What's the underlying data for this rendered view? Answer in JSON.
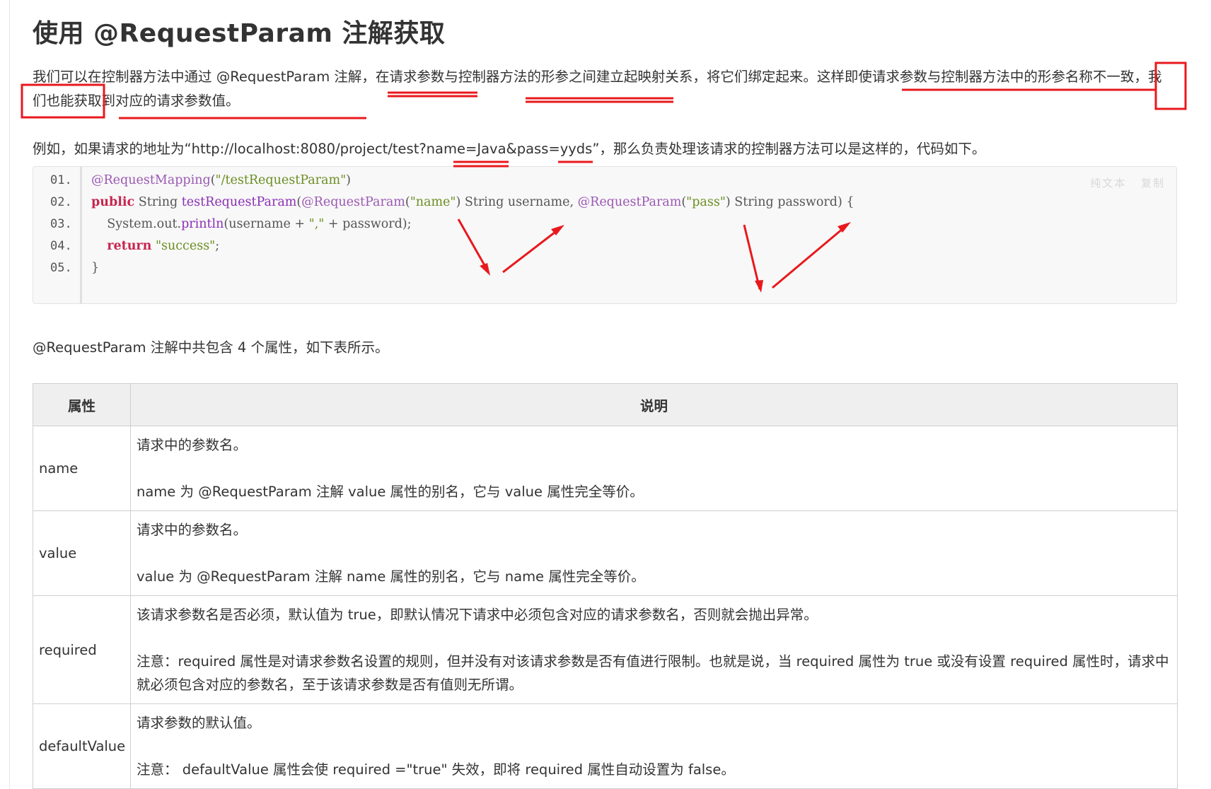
{
  "heading": "使用 @RequestParam 注解获取",
  "intro": {
    "text": "我们可以在控制器方法中通过 @RequestParam 注解，在请求参数与控制器方法的形参之间建立起映射关系，将它们绑定起来。这样即使请求参数与控制器方法中的形参名称不一致，我们也能获取到对应的请求参数值。"
  },
  "example": {
    "text": "例如，如果请求的地址为“http://localhost:8080/project/test?name=Java&pass=yyds”，那么负责处理该请求的控制器方法可以是这样的，代码如下。"
  },
  "code_block": {
    "toolbar": {
      "plain_text": "纯文本",
      "copy": "复制"
    },
    "line_numbers": [
      "01.",
      "02.",
      "03.",
      "04.",
      "05."
    ],
    "lines": [
      "@RequestMapping(\"/testRequestParam\")",
      "public String testRequestParam(@RequestParam(\"name\") String username, @RequestParam(\"pass\") String password) {",
      "    System.out.println(username + \",\" + password);",
      "    return \"success\";",
      "}"
    ]
  },
  "table_intro": "@RequestParam 注解中共包含 4 个属性，如下表所示。",
  "table": {
    "headers": [
      "属性",
      "说明"
    ],
    "rows": [
      {
        "attr": "name",
        "desc": [
          "请求中的参数名。",
          "name 为 @RequestParam 注解 value 属性的别名，它与 value 属性完全等价。"
        ]
      },
      {
        "attr": "value",
        "desc": [
          "请求中的参数名。",
          "value 为 @RequestParam 注解 name 属性的别名，它与 name 属性完全等价。"
        ]
      },
      {
        "attr": "required",
        "desc": [
          "该请求参数名是否必须，默认值为 true，即默认情况下请求中必须包含对应的请求参数名，否则就会抛出异常。",
          "注意：required 属性是对请求参数名设置的规则，但并没有对该请求参数是否有值进行限制。也就是说，当 required 属性为 true 或没有设置 required 属性时，请求中就必须包含对应的参数名，至于该请求参数是否有值则无所谓。"
        ]
      },
      {
        "attr": "defaultValue",
        "desc": [
          "请求参数的默认值。",
          "注意： defaultValue 属性会使 required =\"true\" 失效，即将 required 属性自动设置为 false。"
        ]
      }
    ]
  },
  "annotation_color": "#e8191d"
}
